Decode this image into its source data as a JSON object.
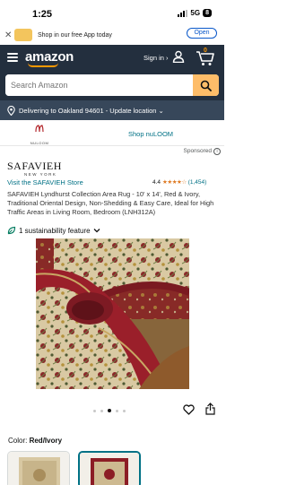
{
  "status_bar": {
    "time": "1:25",
    "network": "5G",
    "battery": "8"
  },
  "app_banner": {
    "text": "Shop in our free App today",
    "open_label": "Open"
  },
  "header": {
    "logo": "amazon",
    "signin_label": "Sign in ›",
    "cart_count": "0"
  },
  "search": {
    "placeholder": "Search Amazon"
  },
  "delivery": {
    "text": "Delivering to Oakland 94601 - Update location ⌄"
  },
  "sponsored_banner": {
    "brand_logo_text": "NULOOM",
    "link_label": "Shop nuLOOM"
  },
  "sponsored_label": "Sponsored",
  "brand": {
    "name": "SAFAVIEH",
    "subtitle": "NEW YORK"
  },
  "store_link": "Visit the SAFAVIEH Store",
  "rating": {
    "value": "4.4",
    "stars": "★★★★☆",
    "count": "(1,454)"
  },
  "product_title": "SAFAVIEH Lyndhurst Collection Area Rug - 10' x 14', Red & Ivory, Traditional Oriental Design, Non-Shedding & Easy Care, Ideal for High Traffic Areas in Living Room, Bedroom (LNH312A)",
  "sustainability": {
    "label": "1 sustainability feature"
  },
  "carousel": {
    "active_index": 2,
    "count": 5
  },
  "color": {
    "label": "Color:",
    "value": "Red/Ivory"
  },
  "icons": [
    "close-icon",
    "menu-icon",
    "user-icon",
    "cart-icon",
    "search-icon",
    "location-pin-icon",
    "info-icon",
    "leaf-icon",
    "chevron-down-icon",
    "heart-icon",
    "share-icon"
  ],
  "colors": {
    "header": "#232f3e",
    "delivery_bar": "#37475a",
    "accent": "#febd69",
    "link": "#007185",
    "stars": "#de7921"
  }
}
